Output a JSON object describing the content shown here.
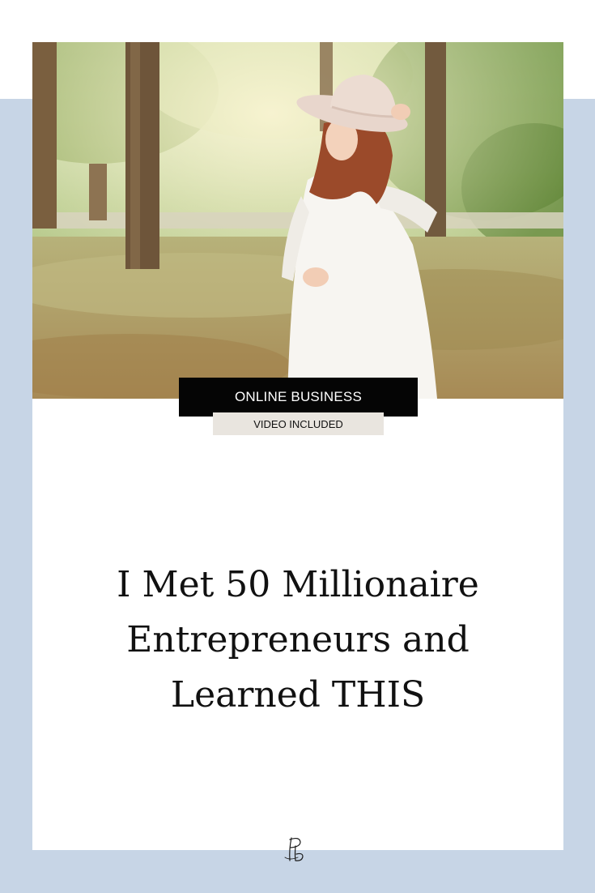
{
  "tags": {
    "category": "ONLINE BUSINESS",
    "subcategory": "VIDEO INCLUDED"
  },
  "headline": {
    "line1": "I Met 50 Millionaire",
    "line2": "Entrepreneurs and",
    "line3": "Learned THIS"
  },
  "logo": {
    "monogram": "pb"
  },
  "colors": {
    "background_band": "#c7d5e6",
    "card": "#ffffff",
    "category_tag_bg": "#050505",
    "category_tag_text": "#ffffff",
    "subcategory_tag_bg": "#e9e5df",
    "headline_text": "#111111"
  },
  "icons": {
    "logo": "pb-monogram-icon"
  }
}
